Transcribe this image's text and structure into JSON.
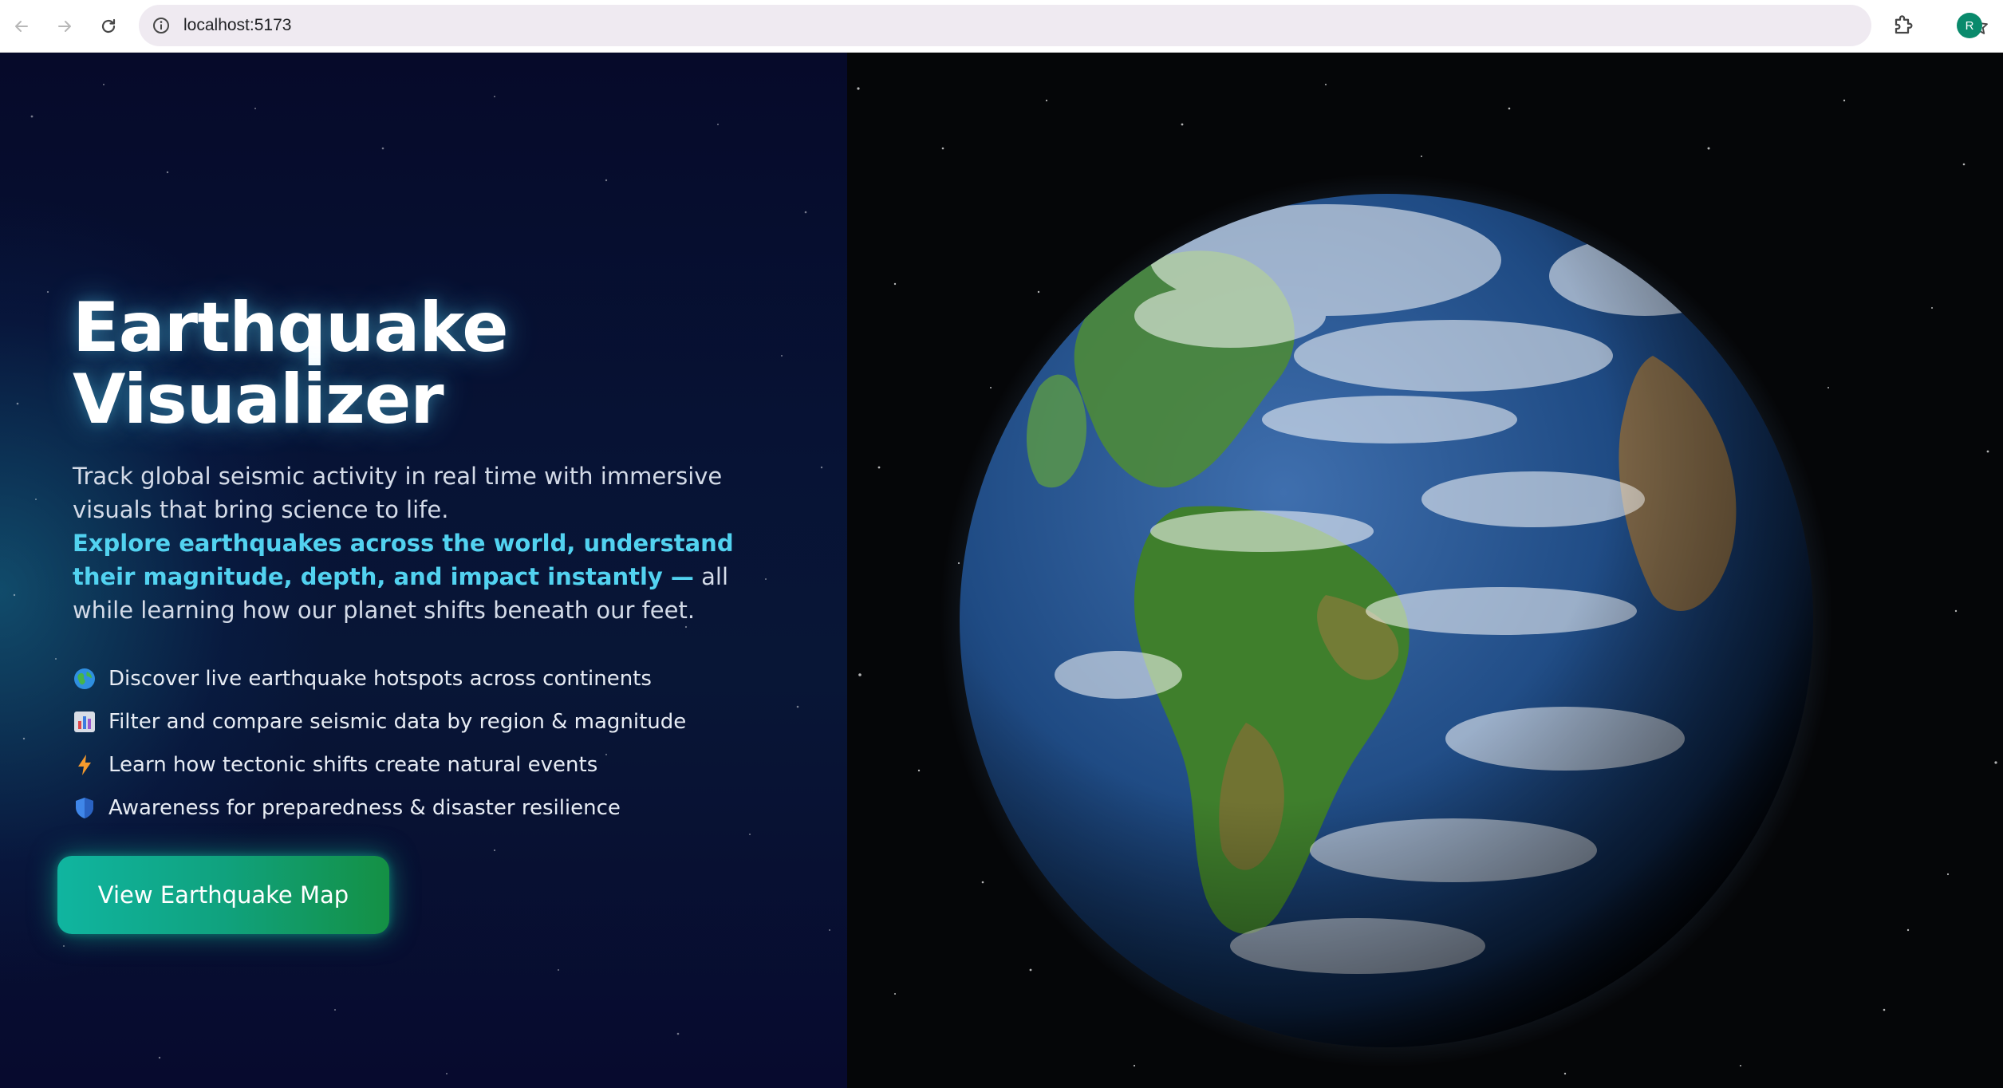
{
  "browser": {
    "url": "localhost:5173",
    "profile_initial": "R",
    "icons": {
      "back": "back-arrow-icon",
      "forward": "forward-arrow-icon",
      "reload": "reload-icon",
      "site_info": "info-icon",
      "bookmark": "star-icon",
      "extensions": "puzzle-icon"
    }
  },
  "hero": {
    "title_line1": "Earthquake",
    "title_line2": "Visualizer",
    "description_intro": "Track global seismic activity in real time with immersive visuals that bring science to life.",
    "description_highlight": "Explore earthquakes across the world, understand their magnitude, depth, and impact instantly —",
    "description_outro": " all while learning how our planet shifts beneath our feet.",
    "features": [
      {
        "icon": "globe-icon",
        "text": "Discover live earthquake hotspots across continents"
      },
      {
        "icon": "bar-chart-icon",
        "text": "Filter and compare seismic data by region & magnitude"
      },
      {
        "icon": "lightning-icon",
        "text": "Learn how tectonic shifts create natural events"
      },
      {
        "icon": "shield-icon",
        "text": "Awareness for preparedness & disaster resilience"
      }
    ],
    "cta_label": "View Earthquake Map"
  },
  "colors": {
    "highlight": "#52d2f0",
    "cta_start": "#10b5a0",
    "cta_end": "#149044",
    "panel_background": "#070f33",
    "space_background": "#050608"
  }
}
